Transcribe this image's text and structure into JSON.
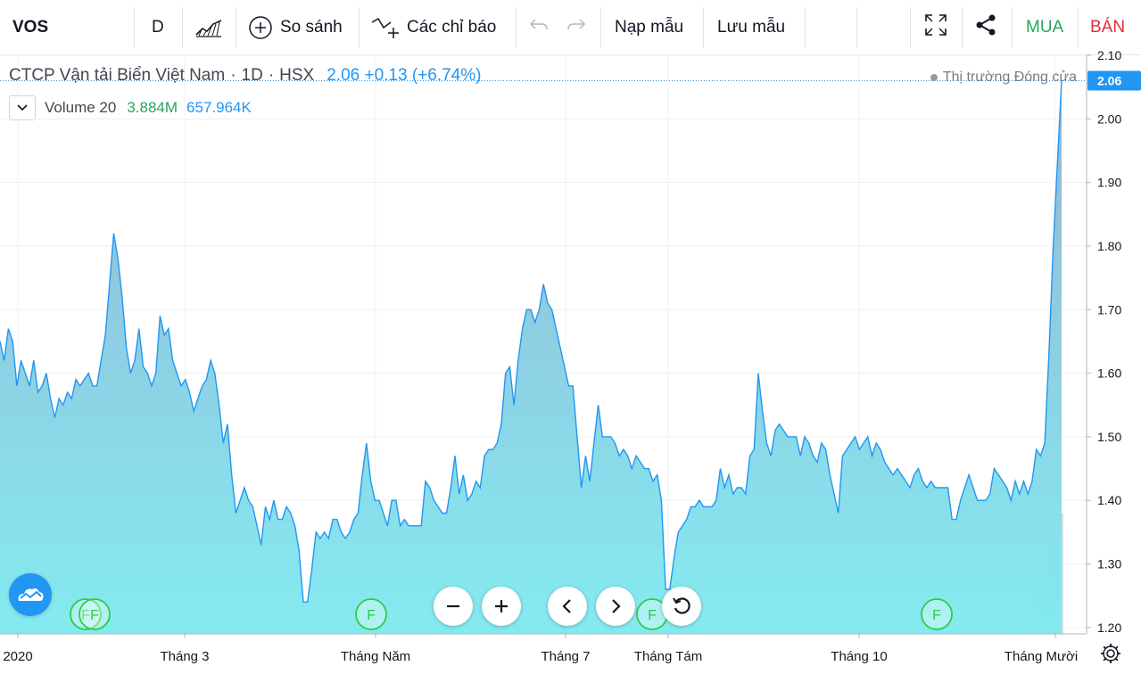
{
  "toolbar": {
    "symbol": "VOS",
    "interval": "D",
    "compare_label": "So sánh",
    "indicators_label": "Các chỉ báo",
    "load_template_label": "Nạp mẫu",
    "save_template_label": "Lưu mẫu",
    "buy_label": "MUA",
    "sell_label": "BÁN"
  },
  "legend": {
    "company": "CTCP Vận tải Biển Việt Nam",
    "sep1": "·",
    "timeframe": "1D",
    "sep2": "·",
    "exchange": "HSX",
    "price_text": "2.06 +0.13 (+6.74%)",
    "volume_label": "Volume 20",
    "volume_value": "3.884M",
    "volume_ma": "657.964K",
    "market_status": "Thị trường Đóng cửa"
  },
  "chart_data": {
    "type": "area",
    "x_ticks": [
      "2020",
      "Tháng 3",
      "Tháng Năm",
      "Tháng 7",
      "Tháng Tám",
      "Tháng 10",
      "Tháng Mười"
    ],
    "y_ticks": [
      "2.10",
      "2.00",
      "1.90",
      "1.80",
      "1.70",
      "1.60",
      "1.50",
      "1.40",
      "1.30",
      "1.20"
    ],
    "ylim": [
      1.19,
      2.1
    ],
    "last_price_label": "2.06",
    "last_price": 2.06,
    "grid": true,
    "series": [
      {
        "values": [
          1.65,
          1.62,
          1.67,
          1.65,
          1.58,
          1.62,
          1.6,
          1.58,
          1.62,
          1.57,
          1.58,
          1.6,
          1.56,
          1.53,
          1.56,
          1.55,
          1.57,
          1.56,
          1.59,
          1.58,
          1.59,
          1.6,
          1.58,
          1.58,
          1.62,
          1.66,
          1.74,
          1.82,
          1.78,
          1.72,
          1.64,
          1.6,
          1.62,
          1.67,
          1.61,
          1.6,
          1.58,
          1.6,
          1.69,
          1.66,
          1.67,
          1.62,
          1.6,
          1.58,
          1.59,
          1.57,
          1.54,
          1.56,
          1.58,
          1.59,
          1.62,
          1.6,
          1.55,
          1.49,
          1.52,
          1.44,
          1.38,
          1.4,
          1.42,
          1.4,
          1.39,
          1.36,
          1.33,
          1.39,
          1.37,
          1.4,
          1.37,
          1.37,
          1.39,
          1.38,
          1.36,
          1.32,
          1.24,
          1.24,
          1.29,
          1.35,
          1.34,
          1.35,
          1.34,
          1.37,
          1.37,
          1.35,
          1.34,
          1.35,
          1.37,
          1.38,
          1.44,
          1.49,
          1.43,
          1.4,
          1.4,
          1.38,
          1.36,
          1.4,
          1.4,
          1.36,
          1.37,
          1.36,
          1.36,
          1.36,
          1.36,
          1.43,
          1.42,
          1.4,
          1.39,
          1.38,
          1.38,
          1.42,
          1.47,
          1.41,
          1.44,
          1.4,
          1.41,
          1.43,
          1.42,
          1.47,
          1.48,
          1.48,
          1.49,
          1.52,
          1.6,
          1.61,
          1.55,
          1.62,
          1.67,
          1.7,
          1.7,
          1.68,
          1.7,
          1.74,
          1.71,
          1.7,
          1.67,
          1.64,
          1.61,
          1.58,
          1.58,
          1.5,
          1.42,
          1.47,
          1.43,
          1.49,
          1.55,
          1.5,
          1.5,
          1.5,
          1.49,
          1.47,
          1.48,
          1.47,
          1.45,
          1.47,
          1.46,
          1.45,
          1.45,
          1.43,
          1.44,
          1.4,
          1.26,
          1.26,
          1.31,
          1.35,
          1.36,
          1.37,
          1.39,
          1.39,
          1.4,
          1.39,
          1.39,
          1.39,
          1.4,
          1.45,
          1.42,
          1.44,
          1.41,
          1.42,
          1.42,
          1.41,
          1.47,
          1.48,
          1.6,
          1.54,
          1.49,
          1.47,
          1.51,
          1.52,
          1.51,
          1.5,
          1.5,
          1.5,
          1.47,
          1.5,
          1.49,
          1.47,
          1.46,
          1.49,
          1.48,
          1.44,
          1.41,
          1.38,
          1.47,
          1.48,
          1.49,
          1.5,
          1.48,
          1.49,
          1.5,
          1.47,
          1.49,
          1.48,
          1.46,
          1.45,
          1.44,
          1.45,
          1.44,
          1.43,
          1.42,
          1.44,
          1.45,
          1.43,
          1.42,
          1.43,
          1.42,
          1.42,
          1.42,
          1.42,
          1.37,
          1.37,
          1.4,
          1.42,
          1.44,
          1.42,
          1.4,
          1.4,
          1.4,
          1.41,
          1.45,
          1.44,
          1.43,
          1.42,
          1.4,
          1.43,
          1.41,
          1.43,
          1.41,
          1.43,
          1.48,
          1.47,
          1.49,
          1.63,
          1.8,
          1.93,
          2.06
        ]
      }
    ],
    "volume_bars_present": true
  },
  "markers": [
    "F",
    "F",
    "F",
    "F",
    "F"
  ],
  "colors": {
    "line": "#2196f3",
    "area_top": "#8fb2d4",
    "area_bottom": "#7eeaf0",
    "buy": "#26a65b",
    "sell": "#e0303a",
    "marker": "#2ecc40"
  },
  "icons": {
    "undo": "undo-icon",
    "redo": "redo-icon",
    "fullscreen": "fullscreen-icon",
    "share": "share-icon",
    "settings": "gear-icon"
  }
}
